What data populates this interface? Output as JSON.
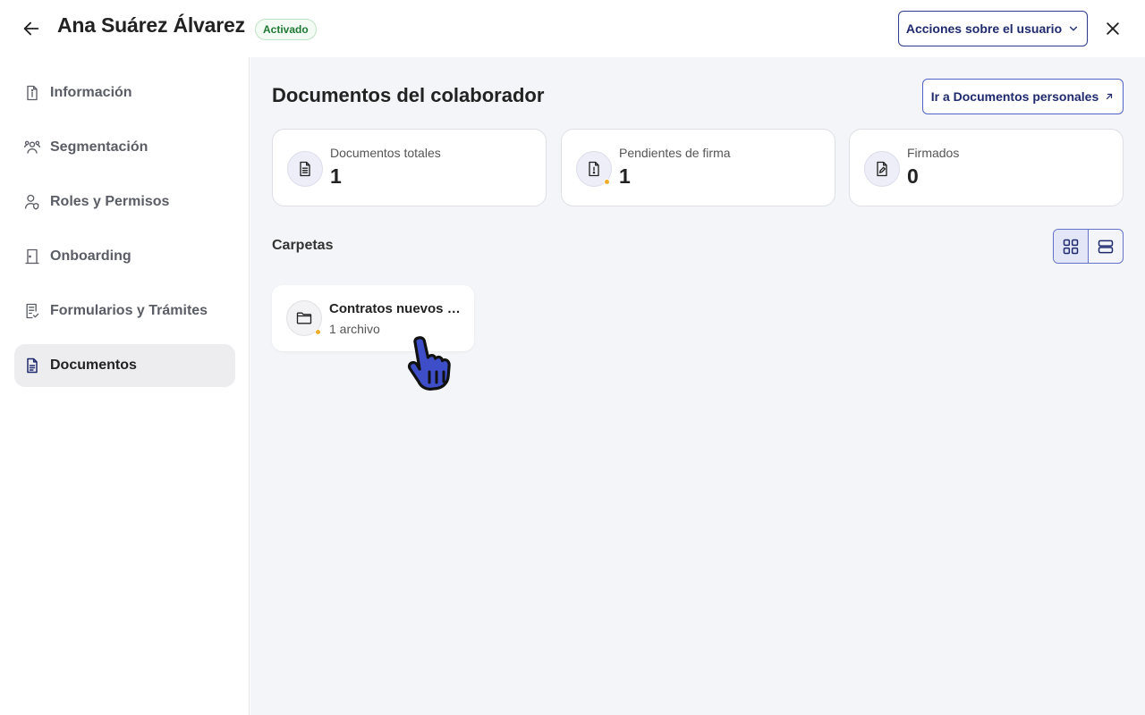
{
  "header": {
    "user_name": "Ana Suárez Álvarez",
    "status_badge": "Activado",
    "actions_button": "Acciones sobre el usuario"
  },
  "sidebar": {
    "items": [
      {
        "label": "Información",
        "icon": "info-document-icon",
        "active": false
      },
      {
        "label": "Segmentación",
        "icon": "people-group-icon",
        "active": false
      },
      {
        "label": "Roles y Permisos",
        "icon": "user-shield-icon",
        "active": false
      },
      {
        "label": "Onboarding",
        "icon": "door-icon",
        "active": false
      },
      {
        "label": "Formularios y Trámites",
        "icon": "form-check-icon",
        "active": false
      },
      {
        "label": "Documentos",
        "icon": "document-icon",
        "active": true
      }
    ]
  },
  "main": {
    "title": "Documentos del colaborador",
    "go_personal_docs_button": "Ir a Documentos personales",
    "stats": [
      {
        "label": "Documentos totales",
        "value": "1",
        "icon": "document-icon"
      },
      {
        "label": "Pendientes de firma",
        "value": "1",
        "icon": "document-alert-icon"
      },
      {
        "label": "Firmados",
        "value": "0",
        "icon": "document-signed-icon"
      }
    ],
    "folders_section": "Carpetas",
    "folders": [
      {
        "name": "Contratos nuevos ingresos",
        "count": "1 archivo"
      }
    ]
  },
  "colors": {
    "accent": "#1f2a6e",
    "pending_dot": "#f0ad2a",
    "status_green": "#1e7a34"
  }
}
